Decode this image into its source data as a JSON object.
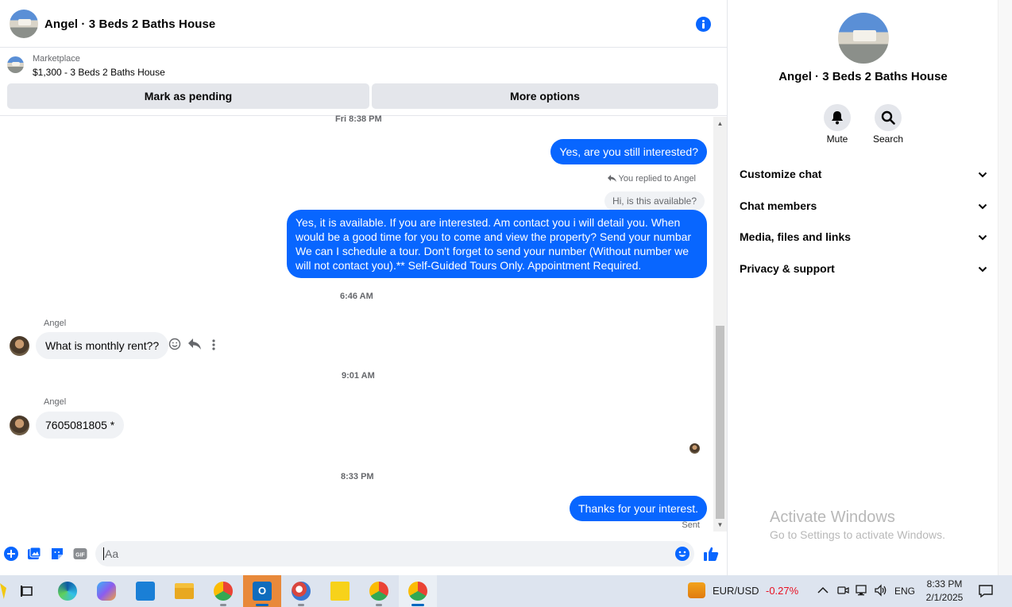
{
  "chat": {
    "title": "Angel · 3 Beds 2 Baths House",
    "marketplace_label": "Marketplace",
    "listing": "$1,300 - 3 Beds 2 Baths House",
    "mark_pending": "Mark as pending",
    "more_options": "More options",
    "messages": {
      "ts1": "Fri 8:38 PM",
      "out1": "Yes, are you still interested?",
      "reply_note": "You replied to Angel",
      "quoted": "Hi, is this available?",
      "out2": "Yes, it is available. If you are interested.  Am contact you i will detail you.  When would be a good time for you to come and view the property? Send your numbar We can I schedule a tour.  Don't forget to send your number (Without number we will not contact you).** Self-Guided Tours Only. Appointment Required.",
      "ts2": "6:46 AM",
      "sender1": "Angel",
      "in1": "What is monthly rent??",
      "ts3": "9:01 AM",
      "sender2": "Angel",
      "in2": "7605081805 *",
      "ts4": "8:33 PM",
      "out3": "Thanks for your interest.",
      "sent": "Sent"
    },
    "composer_placeholder": "Aa"
  },
  "panel": {
    "title": "Angel · 3 Beds 2 Baths House",
    "mute": "Mute",
    "search": "Search",
    "sections": [
      "Customize chat",
      "Chat members",
      "Media, files and links",
      "Privacy & support"
    ]
  },
  "watermark": {
    "line1": "Activate Windows",
    "line2": "Go to Settings to activate Windows."
  },
  "taskbar": {
    "ticker": "EUR/USD",
    "change": "-0.27%",
    "lang": "ENG",
    "time": "8:33 PM",
    "date": "2/1/2025"
  },
  "colors": {
    "accent": "#0866ff",
    "negative": "#e81123"
  }
}
